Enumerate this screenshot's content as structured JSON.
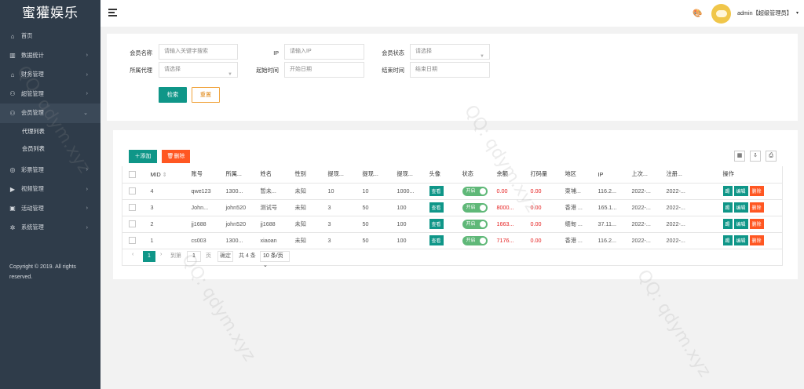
{
  "sidebar": {
    "logo": "蜜獾娱乐",
    "items": [
      {
        "label": "首页",
        "icon": "home-icon",
        "glyph": "⌂",
        "arrow": ""
      },
      {
        "label": "数据统计",
        "icon": "chart-icon",
        "glyph": "▥",
        "arrow": "›"
      },
      {
        "label": "财务管理",
        "icon": "bank-icon",
        "glyph": "⌂",
        "arrow": "›"
      },
      {
        "label": "超管管理",
        "icon": "user-icon",
        "glyph": "⚇",
        "arrow": "›"
      },
      {
        "label": "会员管理",
        "icon": "group-icon",
        "glyph": "⚇",
        "arrow": "⌄"
      }
    ],
    "sub_items": [
      {
        "label": "代理列表"
      },
      {
        "label": "会员列表"
      }
    ],
    "items2": [
      {
        "label": "彩票管理",
        "icon": "gamepad-icon",
        "glyph": "◎",
        "arrow": "›"
      },
      {
        "label": "视频管理",
        "icon": "video-icon",
        "glyph": "▶",
        "arrow": "›"
      },
      {
        "label": "活动管理",
        "icon": "ticket-icon",
        "glyph": "▣",
        "arrow": "›"
      },
      {
        "label": "系统管理",
        "icon": "settings-icon",
        "glyph": "✲",
        "arrow": "›"
      }
    ],
    "copyright": "Copyright © 2019. All rights reserved."
  },
  "header": {
    "user": "admin【超级管理员】"
  },
  "search": {
    "member_name_label": "会员名称",
    "member_name_placeholder": "请输入关键字搜索",
    "ip_label": "IP",
    "ip_placeholder": "请输入IP",
    "status_label": "会员状态",
    "status_placeholder": "请选择",
    "agent_label": "所属代理",
    "agent_placeholder": "请选择",
    "start_label": "起始时间",
    "start_placeholder": "开始日期",
    "end_label": "结束时间",
    "end_placeholder": "结束日期",
    "search_button": "检索",
    "reset_button": "重置"
  },
  "toolbar": {
    "add": "添加",
    "delete": "删除"
  },
  "table": {
    "headers": [
      "MID",
      "账号",
      "所属...",
      "姓名",
      "性别",
      "提现...",
      "提现...",
      "提现...",
      "头像",
      "状态",
      "余额",
      "打码量",
      "地区",
      "IP",
      "上次...",
      "注册...",
      "操作"
    ],
    "rows": [
      {
        "mid": "4",
        "account": "qwe123",
        "agent": "1300...",
        "name": "暂未...",
        "gender": "未知",
        "w1": "10",
        "w2": "10",
        "w3": "1000...",
        "view": "查看",
        "status": "开启",
        "balance": "0.00",
        "bet": "0.00",
        "region": "柬埔...",
        "ip": "116.2...",
        "last": "2022-...",
        "reg": "2022-..."
      },
      {
        "mid": "3",
        "account": "John...",
        "agent": "john520",
        "name": "测试号",
        "gender": "未知",
        "w1": "3",
        "w2": "50",
        "w3": "100",
        "view": "查看",
        "status": "开启",
        "balance": "8000...",
        "bet": "0.00",
        "region": "香港 ...",
        "ip": "165.1...",
        "last": "2022-...",
        "reg": "2022-..."
      },
      {
        "mid": "2",
        "account": "jj1688",
        "agent": "john520",
        "name": "jj1688",
        "gender": "未知",
        "w1": "3",
        "w2": "50",
        "w3": "100",
        "view": "查看",
        "status": "开启",
        "balance": "1663...",
        "bet": "0.00",
        "region": "缅甸 ...",
        "ip": "37.11...",
        "last": "2022-...",
        "reg": "2022-..."
      },
      {
        "mid": "1",
        "account": "cs003",
        "agent": "1300...",
        "name": "xiaoan",
        "gender": "未知",
        "w1": "3",
        "w2": "50",
        "w3": "100",
        "view": "查看",
        "status": "开启",
        "balance": "7176...",
        "bet": "0.00",
        "region": "香港 ...",
        "ip": "116.2...",
        "last": "2022-...",
        "reg": "2022-..."
      }
    ],
    "actions": {
      "a1": "踢",
      "a2": "编辑",
      "a3": "删除"
    }
  },
  "pager": {
    "current": "1",
    "goto_label": "到第",
    "page_input": "1",
    "page_unit": "页",
    "confirm": "确定",
    "total": "共 4 条",
    "per_page": "10 条/页"
  },
  "watermark": "QQ: qdym.xyz"
}
